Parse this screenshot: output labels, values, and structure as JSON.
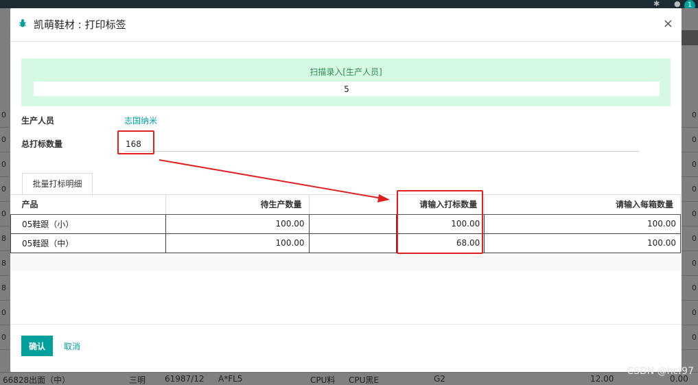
{
  "topbar": {
    "notification_count": "1"
  },
  "background": {
    "right_values": [
      "0",
      "0",
      "0",
      "0",
      "0",
      "0",
      "0",
      "0",
      "0",
      "0"
    ],
    "left_values": [
      "0",
      "0",
      "0",
      "0",
      "0",
      "8",
      "8",
      "8",
      "0",
      "0"
    ],
    "bottom_row": {
      "c1": "66828出面（中）",
      "c2": "三明",
      "c3": "61987/12",
      "c4": "A*FL5",
      "c5": "CPU料",
      "c6": "CPU黑E",
      "c7": "G2",
      "c8": "12.00",
      "c9": "0.00"
    }
  },
  "watermark": "CSDN @hcf97",
  "modal": {
    "title": "凯萌鞋材 : 打印标签",
    "close": "×",
    "scan": {
      "label": "扫描录入[生产人员]",
      "value": "5"
    },
    "producer_label": "生产人员",
    "producer_value": "志国纳米",
    "total_label": "总打标数量",
    "total_value": "168",
    "tab_label": "批量打标明细",
    "table": {
      "headers": [
        "产品",
        "待生产数量",
        "",
        "请输入打标数量",
        "请输入每箱数量"
      ],
      "rows": [
        [
          "05鞋跟（小）",
          "100.00",
          "",
          "100.00",
          "100.00"
        ],
        [
          "05鞋跟（中）",
          "100.00",
          "",
          "68.00",
          "100.00"
        ]
      ]
    },
    "confirm_label": "确认",
    "cancel_label": "取消"
  },
  "colors": {
    "accent": "#00a09d",
    "annotation": "#e0201e",
    "scan_bg": "#d5f9e3"
  }
}
